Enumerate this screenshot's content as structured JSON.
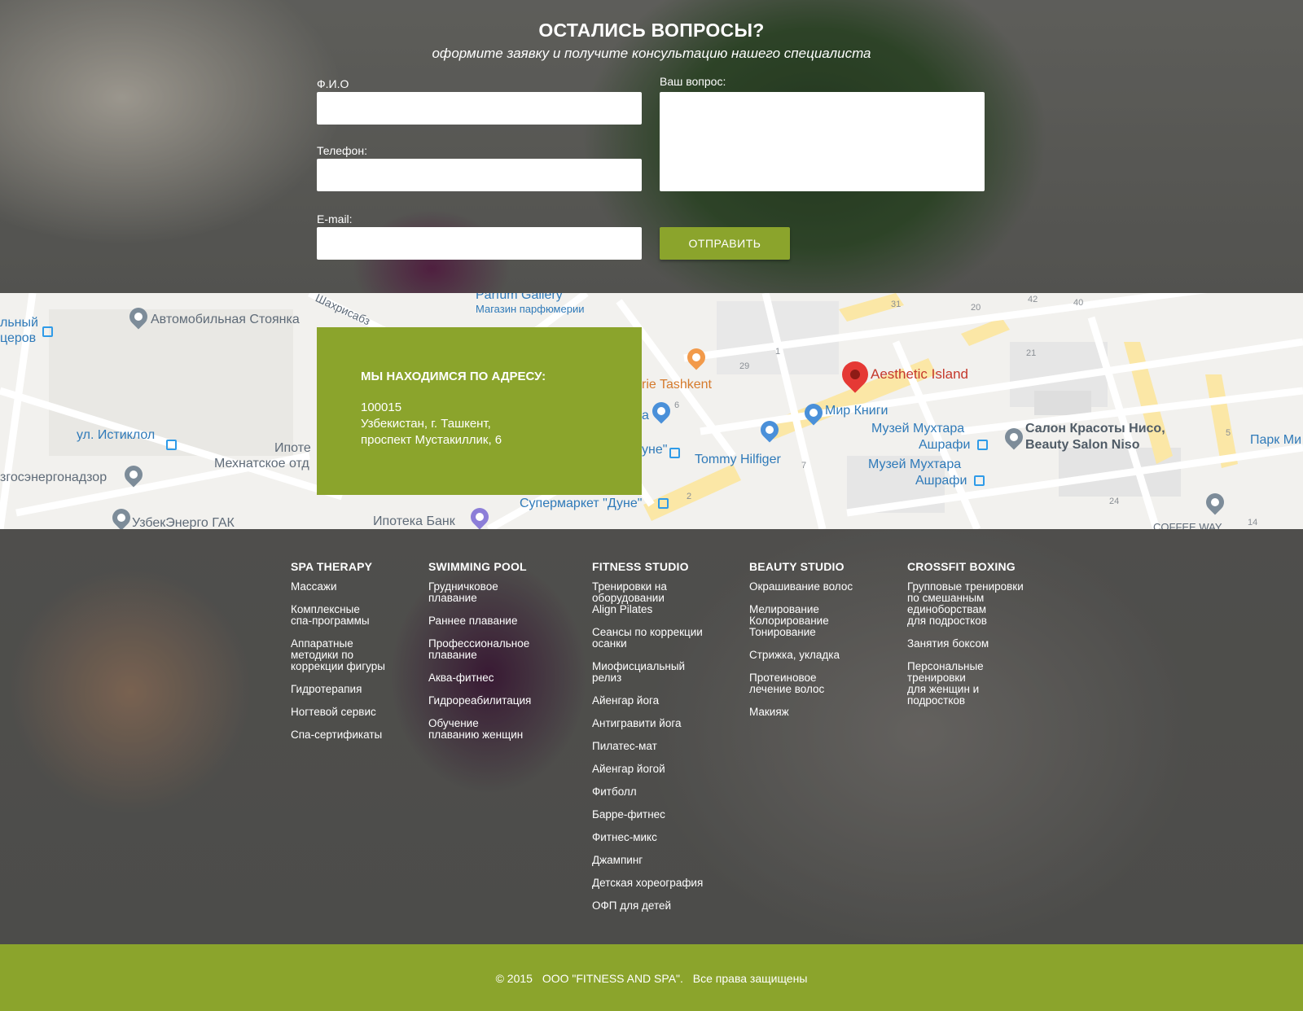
{
  "contact": {
    "title": "ОСТАЛИСЬ ВОПРОСЫ?",
    "subtitle": "оформите заявку и получите консультацию нашего специалиста",
    "fields": {
      "name_label": "Ф.И.О",
      "phone_label": "Телефон:",
      "email_label": "E-mail:",
      "question_label": "Ваш вопрос:"
    },
    "submit_label": "ОТПРАВИТЬ"
  },
  "map": {
    "labels": {
      "parking": "Автомобильная Стоянка",
      "parfum": "Parfum Gallery",
      "parfum_sub": "Магазин парфюмерии",
      "zahrisabz": "Шахрисабз",
      "left_top1": "льный",
      "left_top2": "церов",
      "istiklol": "ул. Истиклол",
      "ipote": "Ипоте",
      "mehnat": "Мехнатское отд",
      "energo": "згосэнергонадзор",
      "uzbekenergo": "УзбекЭнерго ГАК",
      "ipoteka": "Ипотека Банк",
      "tashkent": "rie Tashkent",
      "aesthetic": "Aesthetic Island",
      "mir_knigi": "Мир Книги",
      "tommy": "Tommy Hilfiger",
      "dune1": "уне\"",
      "dune_super": "Супермаркет \"Дуне\"",
      "muzey1a": "Музей Мухтара",
      "muzey1b": "Ашрафи",
      "muzey2a": "Музей Мухтара",
      "muzey2b": "Ашрафи",
      "salon1": "Салон Красоты Нисо,",
      "salon2": "Beauty Salon Niso",
      "park": "Парк Ми",
      "coffee": "COFFEE WAY",
      "a_letter": "a"
    },
    "numbers": [
      "31",
      "20",
      "42",
      "40",
      "29",
      "1",
      "21",
      "6",
      "7",
      "5",
      "2",
      "24",
      "14"
    ]
  },
  "address": {
    "title": "МЫ НАХОДИМСЯ ПО АДРЕСУ:",
    "line1": "100015",
    "line2": "Узбекистан, г. Ташкент,",
    "line3": "проспект Мустакиллик, 6"
  },
  "footer": {
    "columns": [
      {
        "title": "SPA THERAPY",
        "items": [
          "Массажи",
          "Комплексные\nспа-программы",
          "Аппаратные\nметодики по\nкоррекции фигуры",
          "Гидротерапия",
          "Ногтевой сервис",
          "Спа-сертификаты"
        ]
      },
      {
        "title": "SWIMMING POOL",
        "items": [
          "Грудничковое\nплавание",
          "Раннее плавание",
          "Профессиональное\nплавание",
          "Аква-фитнес",
          "Гидрореабилитация",
          "Обучение\nплаванию женщин"
        ]
      },
      {
        "title": "FITNESS STUDIO",
        "items": [
          "Тренировки на\nоборудовании\nAlign Pilates",
          "Сеансы по коррекции\nосанки",
          "Миофисциальный\nрелиз",
          "Айенгар йога",
          "Антигравити йога",
          "Пилатес-мат",
          "Айенгар йогой",
          "Фитболл",
          "Барре-фитнес",
          "Фитнес-микс",
          "Джампинг",
          "Детская хореография",
          "ОФП для детей"
        ]
      },
      {
        "title": "BEAUTY STUDIO",
        "items": [
          "Окрашивание волос",
          "Мелирование\nКолорирование\nТонирование",
          "Стрижка, укладка",
          "Протеиновое\nлечение волос",
          "Макияж"
        ]
      },
      {
        "title": "CROSSFIT BOXING",
        "items": [
          "Групповые тренировки\nпо смешанным\nединоборствам\nдля подростков",
          "Занятия боксом",
          "Персональные\nтренировки\nдля женщин и\nподростков"
        ]
      }
    ]
  },
  "bottom": {
    "year": "© 2015",
    "company": "ООО \"FITNESS AND SPA\".",
    "rights": "Все права защищены"
  },
  "colors": {
    "accent": "#8ba42c",
    "map_pin": "#e53935"
  }
}
